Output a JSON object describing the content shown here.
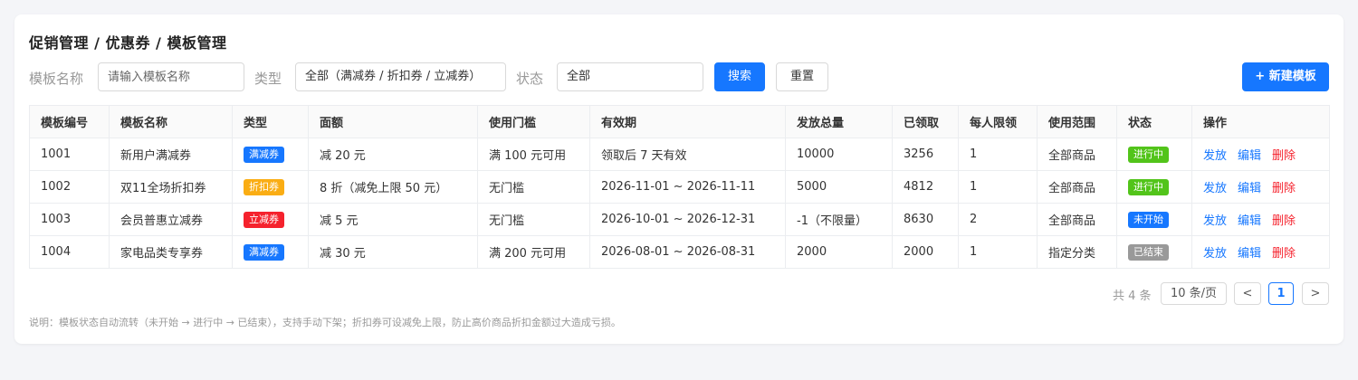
{
  "breadcrumb": "促销管理 / 优惠券 / 模板管理",
  "filters": {
    "name_label": "模板名称",
    "name_placeholder": "请输入模板名称",
    "type_label": "类型",
    "type_value": "全部（满减券 / 折扣券 / 立减券）",
    "status_label": "状态",
    "status_value": "全部",
    "search_label": "搜索",
    "reset_label": "重置",
    "new_label": "+ 新建模板"
  },
  "table": {
    "headers": [
      "模板编号",
      "模板名称",
      "类型",
      "面额",
      "使用门槛",
      "有效期",
      "发放总量",
      "已领取",
      "每人限领",
      "使用范围",
      "状态",
      "操作"
    ],
    "rows": [
      {
        "id": "1001",
        "name": "新用户满减券",
        "type": "满减券",
        "type_color": "#1677ff",
        "amount": "减 20 元",
        "threshold": "满 100 元可用",
        "validity": "领取后 7 天有效",
        "total": "10000",
        "claimed": "3256",
        "limit": "1",
        "scope": "全部商品",
        "status": "进行中",
        "status_color": "#52c41a"
      },
      {
        "id": "1002",
        "name": "双11全场折扣券",
        "type": "折扣券",
        "type_color": "#faad14",
        "amount": "8 折（减免上限 50 元）",
        "threshold": "无门槛",
        "validity": "2026-11-01 ~ 2026-11-11",
        "total": "5000",
        "claimed": "4812",
        "limit": "1",
        "scope": "全部商品",
        "status": "进行中",
        "status_color": "#52c41a"
      },
      {
        "id": "1003",
        "name": "会员普惠立减券",
        "type": "立减券",
        "type_color": "#f5222d",
        "amount": "减 5 元",
        "threshold": "无门槛",
        "validity": "2026-10-01 ~ 2026-12-31",
        "total": "-1（不限量）",
        "claimed": "8630",
        "limit": "2",
        "scope": "全部商品",
        "status": "未开始",
        "status_color": "#1677ff"
      },
      {
        "id": "1004",
        "name": "家电品类专享券",
        "type": "满减券",
        "type_color": "#1677ff",
        "amount": "减 30 元",
        "threshold": "满 200 元可用",
        "validity": "2026-08-01 ~ 2026-08-31",
        "total": "2000",
        "claimed": "2000",
        "limit": "1",
        "scope": "指定分类",
        "status": "已结束",
        "status_color": "#999999"
      }
    ],
    "actions": {
      "issue": "发放",
      "edit": "编辑",
      "delete": "删除"
    }
  },
  "pagination": {
    "total_text": "共 4 条",
    "page_size": "10 条/页",
    "prev": "<",
    "current": "1",
    "next": ">"
  },
  "note": "说明：模板状态自动流转（未开始 → 进行中 → 已结束），支持手动下架；折扣券可设减免上限，防止高价商品折扣金额过大造成亏损。"
}
